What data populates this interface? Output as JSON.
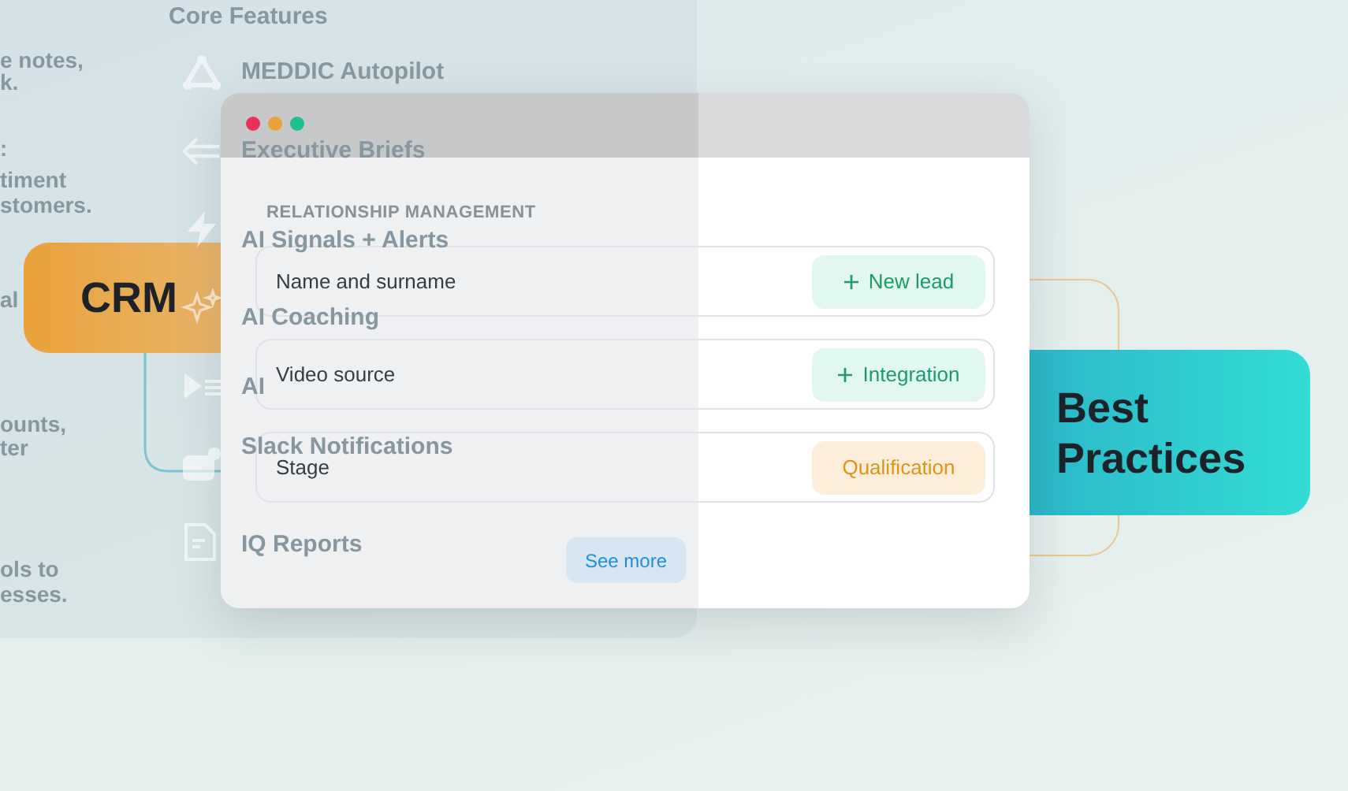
{
  "background_panel": {
    "cut_text": [
      "e notes,",
      "k.",
      ":",
      "timent",
      "stomers.",
      "al",
      "ounts,",
      "ter",
      "ols to",
      "esses."
    ],
    "title": "Core Features",
    "features": [
      {
        "label": "MEDDIC Autopilot",
        "kind": "triangle"
      },
      {
        "label": "Executive Briefs",
        "kind": "lines"
      },
      {
        "label": "AI Signals + Alerts",
        "kind": "bolt"
      },
      {
        "label": "AI Coaching",
        "kind": "sparkles"
      },
      {
        "label": "AI",
        "kind": "play"
      },
      {
        "label": "Slack Notifications",
        "kind": "chat"
      },
      {
        "label": "IQ Reports",
        "kind": "doc"
      }
    ]
  },
  "badges": [
    {
      "label": "CRM",
      "kind": "orange"
    },
    {
      "label": "Best Practices",
      "kind": "teal"
    }
  ],
  "window": {
    "dots": [
      {
        "color": "#e8315b"
      },
      {
        "color": "#e9a23b"
      },
      {
        "color": "#1fbf8f"
      }
    ],
    "section_title": "RELATIONSHIP MANAGEMENT",
    "rows": [
      {
        "label": "Name and surname",
        "chip": {
          "label": "New lead",
          "kind": "action"
        }
      },
      {
        "label": "Video source",
        "chip": {
          "label": "Integration",
          "kind": "action"
        }
      },
      {
        "label": "Stage",
        "chip": {
          "label": "Qualification",
          "kind": "status"
        }
      }
    ],
    "button": "See more"
  }
}
